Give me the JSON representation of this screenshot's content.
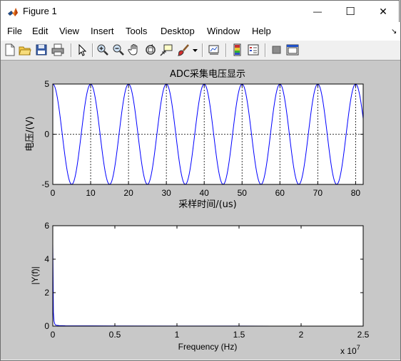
{
  "window": {
    "title": "Figure 1",
    "minimize_glyph": "—",
    "maximize_glyph": "☐",
    "close_glyph": "✕"
  },
  "menu": [
    "File",
    "Edit",
    "View",
    "Insert",
    "Tools",
    "Desktop",
    "Window",
    "Help"
  ],
  "menu_overflow_glyph": "↘",
  "toolbar_icons": [
    "new-figure-icon",
    "open-file-icon",
    "save-icon",
    "print-icon",
    "edit-plot-arrow-icon",
    "zoom-in-icon",
    "zoom-out-icon",
    "pan-hand-icon",
    "rotate-3d-icon",
    "data-cursor-icon",
    "brush-icon",
    "brush-dropdown-icon",
    "link-plot-icon",
    "insert-colorbar-icon",
    "insert-legend-icon",
    "hide-plot-tools-icon",
    "show-plot-tools-icon"
  ],
  "colors": {
    "plot_line": "#0000ff",
    "figure_bg": "#c8c8c8",
    "axes_bg": "#ffffff",
    "matlab_orange": "#e8751a"
  },
  "chart_data": [
    {
      "type": "line",
      "title": "ADC采集电压显示",
      "xlabel": "采样时间/(us)",
      "ylabel": "电压/(V)",
      "xlim": [
        0,
        82
      ],
      "ylim": [
        -5,
        5
      ],
      "xticks": [
        0,
        10,
        20,
        30,
        40,
        50,
        60,
        70,
        80
      ],
      "yticks": [
        -5,
        0,
        5
      ],
      "grid": true,
      "series": [
        {
          "function": "5*cos(2*pi*x/10)",
          "amplitude": 5,
          "period": 10,
          "x_range": [
            0,
            82
          ]
        }
      ]
    },
    {
      "type": "line",
      "title": "",
      "xlabel": "Frequency (Hz)",
      "ylabel": "|Y(f)|",
      "xlim": [
        0,
        2.5
      ],
      "ylim": [
        0,
        6
      ],
      "xticks": [
        0,
        0.5,
        1,
        1.5,
        2,
        2.5
      ],
      "yticks": [
        0,
        2,
        4,
        6
      ],
      "x_multiplier": "x 10",
      "x_multiplier_exponent": "7",
      "grid": false,
      "series": [
        {
          "x": [
            0,
            0.005,
            0.01,
            0.015,
            0.02,
            0.03,
            0.05,
            0.1,
            0.5,
            1.0,
            1.5,
            2.0,
            2.5
          ],
          "y": [
            4.9,
            0.8,
            0.3,
            0.15,
            0.08,
            0.05,
            0.03,
            0.02,
            0.01,
            0.005,
            0.003,
            0.002,
            0.001
          ]
        }
      ]
    }
  ]
}
